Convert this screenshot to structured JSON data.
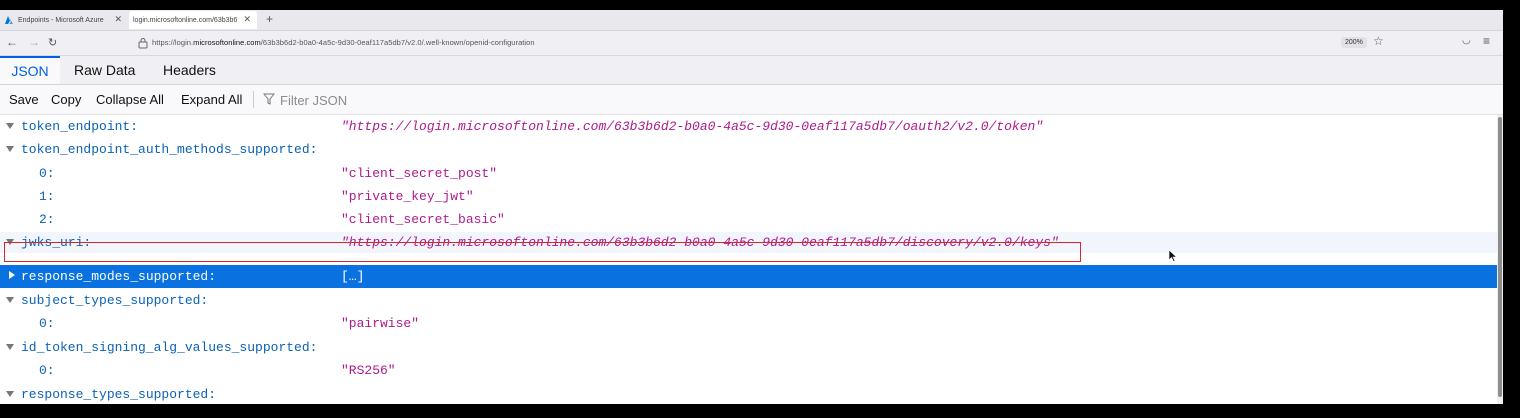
{
  "browser": {
    "tabs": [
      {
        "title": "Endpoints - Microsoft Azure"
      },
      {
        "title": "login.microsoftonline.com/63b3b6"
      }
    ],
    "url_prefix": "https://login.",
    "url_domain": "microsoftonline.com",
    "url_rest": "/63b3b6d2-b0a0-4a5c-9d30-0eaf117a5db7/v2.0/.well-known/openid-configuration",
    "zoom": "200%"
  },
  "viewer": {
    "tabs": [
      {
        "label": "JSON"
      },
      {
        "label": "Raw Data"
      },
      {
        "label": "Headers"
      }
    ],
    "toolbar": {
      "save": "Save",
      "copy": "Copy",
      "collapse_all": "Collapse All",
      "expand_all": "Expand All",
      "filter_placeholder": "Filter JSON"
    }
  },
  "rows": [
    {
      "key": "token_endpoint:",
      "value": "\"https://login.microsoftonline.com/63b3b6d2-b0a0-4a5c-9d30-0eaf117a5db7/oauth2/v2.0/token\""
    },
    {
      "key": "token_endpoint_auth_methods_supported:",
      "value": ""
    },
    {
      "key": "0:",
      "value": "\"client_secret_post\""
    },
    {
      "key": "1:",
      "value": "\"private_key_jwt\""
    },
    {
      "key": "2:",
      "value": "\"client_secret_basic\""
    },
    {
      "key": "jwks_uri:",
      "value": "\"https://login.microsoftonline.com/63b3b6d2-b0a0-4a5c-9d30-0eaf117a5db7/discovery/v2.0/keys\""
    },
    {
      "key": "response_modes_supported:",
      "value": "[…]"
    },
    {
      "key": "subject_types_supported:",
      "value": ""
    },
    {
      "key": "0:",
      "value": "\"pairwise\""
    },
    {
      "key": "id_token_signing_alg_values_supported:",
      "value": ""
    },
    {
      "key": "0:",
      "value": "\"RS256\""
    },
    {
      "key": "response_types_supported:",
      "value": ""
    }
  ]
}
